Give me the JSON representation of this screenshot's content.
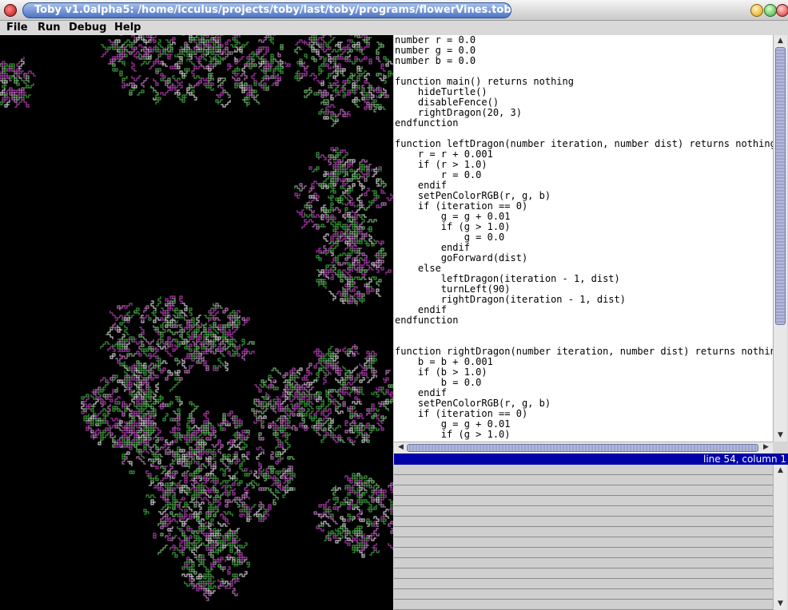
{
  "window": {
    "title": "Toby v1.0alpha5: /home/icculus/projects/toby/last/toby/programs/flowerVines.toby"
  },
  "menu": {
    "items": [
      "File",
      "Run",
      "Debug",
      "Help"
    ]
  },
  "editor": {
    "code": "number r = 0.0\nnumber g = 0.0\nnumber b = 0.0\n\nfunction main() returns nothing\n    hideTurtle()\n    disableFence()\n    rightDragon(20, 3)\nendfunction\n\nfunction leftDragon(number iteration, number dist) returns nothing\n    r = r + 0.001\n    if (r > 1.0)\n        r = 0.0\n    endif\n    setPenColorRGB(r, g, b)\n    if (iteration == 0)\n        g = g + 0.01\n        if (g > 1.0)\n            g = 0.0\n        endif\n        goForward(dist)\n    else\n        leftDragon(iteration - 1, dist)\n        turnLeft(90)\n        rightDragon(iteration - 1, dist)\n    endif\nendfunction\n\n\nfunction rightDragon(number iteration, number dist) returns nothing\n    b = b + 0.001\n    if (b > 1.0)\n        b = 0.0\n    endif\n    setPenColorRGB(r, g, b)\n    if (iteration == 0)\n        g = g + 0.01\n        if (g > 1.0)"
  },
  "status": {
    "cursor_position": "line 54, column 1"
  },
  "colors": {
    "title_accent": "#4d74c4",
    "status_bar": "#0000a8",
    "canvas_bg": "#000000",
    "magenta": "#c040c0",
    "green": "#40b040",
    "white": "#e8e8e8"
  }
}
